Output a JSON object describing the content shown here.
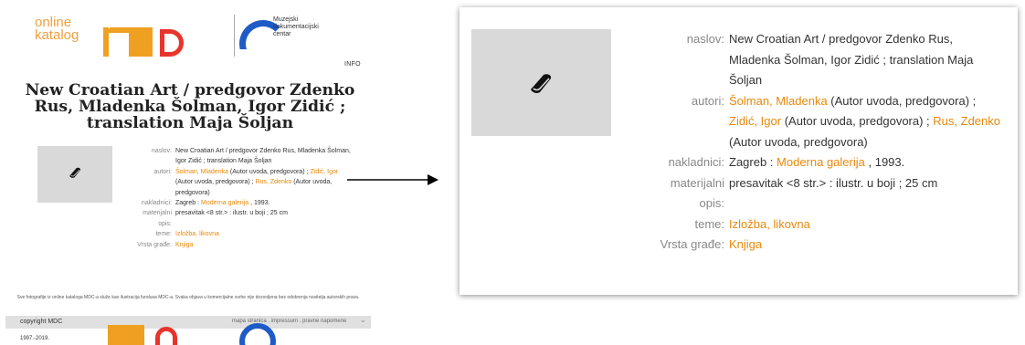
{
  "thumbnail": {
    "logo_online": [
      "online",
      "katalog"
    ],
    "logo_mdc": [
      "Muzejski",
      "dokumentacijski",
      "centar"
    ],
    "info_link": "INFO",
    "title": "New Croatian Art / predgovor Zdenko Rus, Mladenka Šolman, Igor Zidić ; translation Maja Šoljan",
    "record": {
      "naslov_label": "naslov:",
      "naslov_value": "New Croatian Art / predgovor Zdenko Rus, Mladenka Šolman, Igor Zidić ; translation Maja Šoljan",
      "autori_label": "autori:",
      "autori": [
        {
          "name": "Šolman, Mladenka",
          "role": " (Autor uvoda, predgovora) ;"
        },
        {
          "name": "Zidić, Igor",
          "role": " (Autor uvoda, predgovora) ;"
        },
        {
          "name": "Rus, Zdenko",
          "role": " (Autor uvoda, predgovora)"
        }
      ],
      "nakladnici_label": "nakladnici:",
      "nakladnici_prefix": "Zagreb : ",
      "nakladnici_link": "Moderna galerija",
      "nakladnici_suffix": " , 1993.",
      "materijalni_label": "materijalni",
      "materijalni_value": "presavitak <8 str.> : ilustr. u boji ; 25 cm",
      "opis_label": "opis:",
      "teme_label": "teme:",
      "teme_value": "Izložba, likovna",
      "vrsta_label": "Vrsta građe:",
      "vrsta_value": "Knjiga"
    },
    "footer_note": "Sve fotografije iz online kataloga MDC-a služe kao ilustracija fundusa MDC-a. Svaka objava u komercijalne svrhe nije dozvoljena bez odobrenja nositelja autorskih prava.",
    "copyright": "copyright MDC",
    "footer_links": "mapa stranica . impressum . pravne napomene",
    "year": "1997.-2019."
  },
  "zoom": {
    "record": {
      "naslov_label": "naslov:",
      "naslov_value": "New Croatian Art / predgovor Zdenko Rus, Mladenka Šolman, Igor Zidić ; translation Maja Šoljan",
      "autori_label": "autori:",
      "autori": [
        {
          "name": "Šolman, Mladenka",
          "role": " (Autor uvoda, predgovora) ;"
        },
        {
          "name": "Zidić, Igor",
          "role": " (Autor uvoda, predgovora) ;"
        },
        {
          "name": "Rus, Zdenko",
          "role": " (Autor uvoda, predgovora)"
        }
      ],
      "nakladnici_label": "nakladnici:",
      "nakladnici_prefix": "Zagreb : ",
      "nakladnici_link": "Moderna galerija",
      "nakladnici_suffix": " , 1993.",
      "materijalni_label": "materijalni",
      "materijalni_value": "presavitak <8 str.> : ilustr. u boji ; 25 cm",
      "opis_label": "opis:",
      "teme_label": "teme:",
      "teme_value": "Izložba, likovna",
      "vrsta_label": "Vrsta građe:",
      "vrsta_value": "Knjiga"
    }
  },
  "icons": {
    "cover_placeholder": "book-icon",
    "arrow": "arrow-right-icon"
  },
  "colors": {
    "link": "#e8890c",
    "label": "#888888",
    "placeholder_bg": "#d9d9d9"
  }
}
